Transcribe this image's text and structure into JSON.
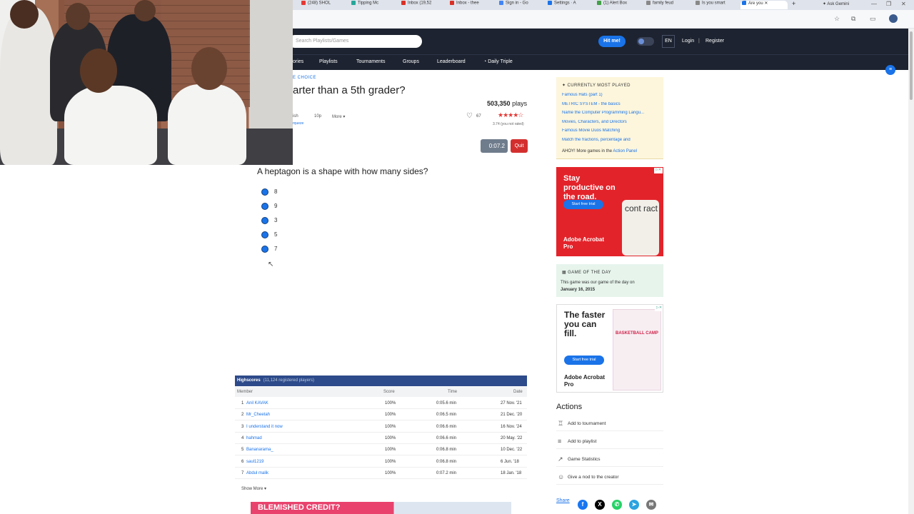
{
  "browser": {
    "tabs": [
      {
        "label": "(248) SHOL",
        "color": "#e53935"
      },
      {
        "label": "Tipping Mc",
        "color": "#26a69a"
      },
      {
        "label": "Inbox (19,52",
        "color": "#d93025"
      },
      {
        "label": "Inbox - thee",
        "color": "#d93025"
      },
      {
        "label": "Sign in - Go",
        "color": "#4285f4"
      },
      {
        "label": "Settings · A",
        "color": "#1a73e8"
      },
      {
        "label": "(1) Alert Box",
        "color": "#43a047"
      },
      {
        "label": "family feud",
        "color": "#888888"
      },
      {
        "label": "Is you smart",
        "color": "#888888"
      },
      {
        "label": "Are you",
        "color": "#1a73e8"
      }
    ],
    "gemini_label": "Ask Gemini",
    "window_controls": [
      "—",
      "❐",
      "✕"
    ]
  },
  "site": {
    "search_placeholder": "Search Playlists/Games",
    "hit_me_label": "Hit me!",
    "lang_label": "EN",
    "login_label": "Login",
    "separator": "|",
    "register_label": "Register",
    "nav": [
      "ories",
      "Playlists",
      "Tournaments",
      "Groups",
      "Leaderboard",
      "Daily Triple"
    ]
  },
  "quiz": {
    "breadcrumb": "E CHOICE",
    "title": "arter than a 5th grader?",
    "plays_count": "503,350",
    "plays_suffix": "plays",
    "meta_a": "ish",
    "meta_points": "10p",
    "meta_more": "More ▾",
    "author_fragment": "rqueze",
    "likes": "67",
    "stars": "★★★★☆",
    "rating_text": "3.74 (you not rated)",
    "rating_value": 3.74,
    "timer": "0:07.2",
    "quit_label": "Quit",
    "question": "A heptagon is a shape with how many sides?",
    "options": [
      "8",
      "9",
      "3",
      "5",
      "7"
    ]
  },
  "highscores": {
    "title": "Highscores",
    "count_text": "(11,124 registered players)",
    "columns": [
      "Member",
      "Score",
      "Time",
      "Date"
    ],
    "rows": [
      {
        "rank": "1",
        "name": "Anil KAVAK",
        "score": "100%",
        "time": "0:05.6 min",
        "date": "27 Nov. '21"
      },
      {
        "rank": "2",
        "name": "Mr_Cheetah",
        "score": "100%",
        "time": "0:06.5 min",
        "date": "21 Dec. '20"
      },
      {
        "rank": "3",
        "name": "I understand it now",
        "score": "100%",
        "time": "0:06.6 min",
        "date": "16 Nov. '24"
      },
      {
        "rank": "4",
        "name": "hahmad",
        "score": "100%",
        "time": "0:06.6 min",
        "date": "20 May. '22"
      },
      {
        "rank": "5",
        "name": "Bananarama_",
        "score": "100%",
        "time": "0:06.8 min",
        "date": "10 Dec. '22"
      },
      {
        "rank": "6",
        "name": "saul1219",
        "score": "100%",
        "time": "0:06.8 min",
        "date": "6 Jun. '18"
      },
      {
        "rank": "7",
        "name": "Abdul malik",
        "score": "100%",
        "time": "0:07.2 min",
        "date": "18 Jan. '18"
      }
    ],
    "show_more": "Show More ▾"
  },
  "bottom_ad": {
    "text": "BLEMISHED CREDIT?"
  },
  "sidebar": {
    "popular_header": "CURRENTLY MOST PLAYED",
    "popular_items": [
      "Famous Hats (part 1)",
      "METRIC SYSTEM - the basics",
      "Name the Computer Programming Langu...",
      "Movies, Characters, and Directors",
      "Famous Movie Duos Matching",
      "Match the fractions, percentage and"
    ],
    "ahoy_text": "AHOY! More games in the",
    "ahoy_link": "Action Panel",
    "ad1": {
      "headline": "Stay productive on the road.",
      "button": "Start free trial",
      "brand": "Adobe Acrobat Pro",
      "card_word": "cont ract"
    },
    "gotd_header": "GAME OF THE DAY",
    "gotd_text": "This game was our game of the day on",
    "gotd_date": "January 16, 2015",
    "ad2": {
      "headline": "The faster you can fill.",
      "button": "Start free trial",
      "brand": "Adobe Acrobat Pro",
      "card_title": "BASKETBALL CAMP"
    },
    "actions_title": "Actions",
    "actions": [
      {
        "label": "Add to tournament",
        "icon": "trophy-icon"
      },
      {
        "label": "Add to playlist",
        "icon": "playlist-icon"
      },
      {
        "label": "Game Statistics",
        "icon": "chart-icon"
      },
      {
        "label": "Give a nod to the creator",
        "icon": "smile-icon"
      }
    ],
    "share_label": "Share",
    "social": [
      {
        "name": "facebook-icon",
        "glyph": "f",
        "color": "#1877f2"
      },
      {
        "name": "x-icon",
        "glyph": "X",
        "color": "#000000"
      },
      {
        "name": "whatsapp-icon",
        "glyph": "✆",
        "color": "#25d366"
      },
      {
        "name": "telegram-icon",
        "glyph": "➤",
        "color": "#2aa3e0"
      },
      {
        "name": "email-icon",
        "glyph": "✉",
        "color": "#777777"
      }
    ]
  }
}
